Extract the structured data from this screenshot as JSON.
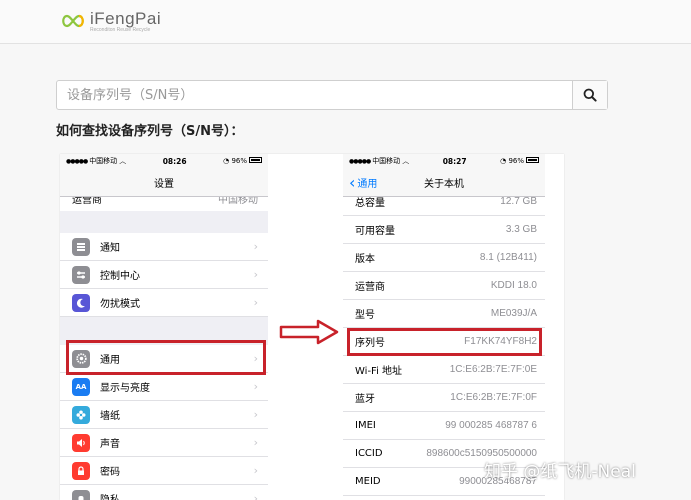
{
  "logo": {
    "name": "iFengPai",
    "tagline": "Reconditon Reuse Recycle"
  },
  "search": {
    "placeholder": "设备序列号（S/N号）"
  },
  "heading": "如何查找设备序列号（S/N号）：",
  "left_phone": {
    "status": {
      "carrier": "中国移动",
      "time": "08:26",
      "battery": "96%"
    },
    "title": "设置",
    "partial_row": {
      "label": "运营商",
      "value": "中国移动"
    },
    "items_group1": [
      {
        "label": "通知",
        "icon": "notification-icon",
        "color": "#8e8e93"
      },
      {
        "label": "控制中心",
        "icon": "control-center-icon",
        "color": "#8e8e93"
      },
      {
        "label": "勿扰模式",
        "icon": "moon-icon",
        "color": "#5856d6"
      }
    ],
    "items_group2": [
      {
        "label": "通用",
        "icon": "gear-icon",
        "color": "#8e8e93"
      },
      {
        "label": "显示与亮度",
        "icon": "display-icon",
        "color": "#1a7cf2"
      },
      {
        "label": "墙纸",
        "icon": "flower-icon",
        "color": "#34aadc"
      },
      {
        "label": "声音",
        "icon": "sound-icon",
        "color": "#ff3b30"
      },
      {
        "label": "密码",
        "icon": "lock-icon",
        "color": "#ff3b30"
      },
      {
        "label": "隐私",
        "icon": "hand-icon",
        "color": "#8e8e93"
      }
    ]
  },
  "right_phone": {
    "status": {
      "carrier": "中国移动",
      "time": "08:27",
      "battery": "96%"
    },
    "back_label": "通用",
    "title": "关于本机",
    "rows": [
      {
        "label": "总容量",
        "value": "12.7 GB"
      },
      {
        "label": "可用容量",
        "value": "3.3 GB"
      },
      {
        "label": "版本",
        "value": "8.1 (12B411)"
      },
      {
        "label": "运营商",
        "value": "KDDI 18.0"
      },
      {
        "label": "型号",
        "value": "ME039J/A"
      },
      {
        "label": "序列号",
        "value": "F17KK74YF8H2"
      },
      {
        "label": "Wi-Fi 地址",
        "value": "1C:E6:2B:7E:7F:0E"
      },
      {
        "label": "蓝牙",
        "value": "1C:E6:2B:7E:7F:0F"
      },
      {
        "label": "IMEI",
        "value": "99 000285 468787 6"
      },
      {
        "label": "ICCID",
        "value": "898600c5150950500000"
      },
      {
        "label": "MEID",
        "value": "99000285468787"
      }
    ]
  },
  "watermark": "知乎 @纸飞机-Neal",
  "colors": {
    "highlight": "#c8222a",
    "ios_blue": "#007aff",
    "logo_green": "#8dc63f",
    "logo_yellow": "#f5b400"
  }
}
